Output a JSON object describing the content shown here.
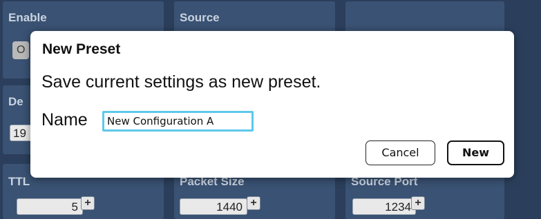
{
  "background": {
    "cells": [
      {
        "label": "Enable"
      },
      {
        "label": "Source"
      },
      {
        "label": ""
      },
      {
        "label": "De"
      },
      {
        "label": ""
      },
      {
        "label": ""
      },
      {
        "label": "TTL"
      },
      {
        "label": "Packet Size"
      },
      {
        "label": "Source Port"
      }
    ],
    "enable_pill": "O",
    "dest_value": "19",
    "ttl_value": "5",
    "packet_size_value": "1440",
    "source_port_value": "1234",
    "stepper_glyph": "+"
  },
  "dialog": {
    "title": "New Preset",
    "message": "Save current settings as new preset.",
    "name_label": "Name",
    "name_value": "New Configuration A",
    "cancel_label": "Cancel",
    "new_label": "New"
  },
  "colors": {
    "background": "#2b3f5c",
    "cell": "#3a5273",
    "focus_ring": "#5cc8ea"
  }
}
